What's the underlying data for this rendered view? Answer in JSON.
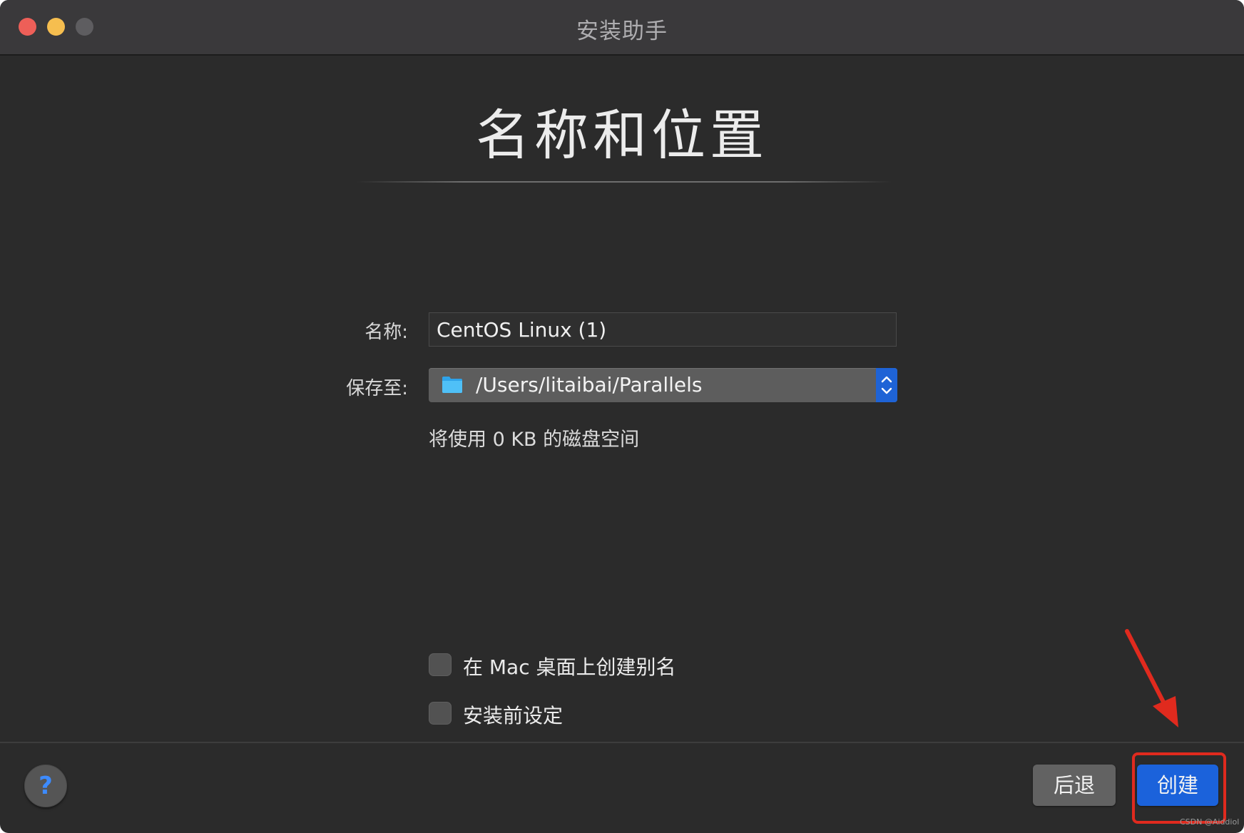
{
  "window": {
    "title": "安装助手"
  },
  "page": {
    "heading": "名称和位置"
  },
  "form": {
    "name_label": "名称:",
    "name_value": "CentOS Linux (1)",
    "save_label": "保存至:",
    "save_path": "/Users/litaibai/Parallels",
    "disk_info": "将使用 0 KB 的磁盘空间"
  },
  "options": {
    "alias_label": "在 Mac 桌面上创建别名",
    "alias_checked": false,
    "pre_install_label": "安装前设定",
    "pre_install_checked": false
  },
  "footer": {
    "help_label": "?",
    "back_label": "后退",
    "create_label": "创建"
  },
  "watermark": "CSDN @Aiddiol",
  "colors": {
    "accent": "#1b62db",
    "annotation": "#e02a1e",
    "window_bg": "#2b2b2b"
  },
  "icons": {
    "folder": "folder-icon",
    "stepper": "chevron-up-down-icon"
  }
}
